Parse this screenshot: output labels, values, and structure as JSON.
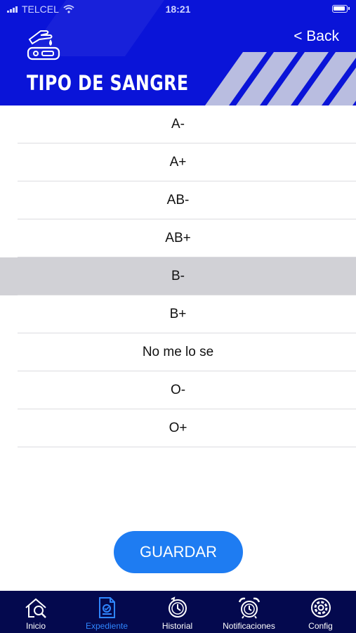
{
  "status_bar": {
    "carrier": "TELCEL",
    "time": "18:21"
  },
  "header": {
    "title": "TIPO DE SANGRE",
    "back_label": "< Back",
    "icon": "blood-test-icon"
  },
  "options": [
    {
      "label": "A-",
      "selected": false
    },
    {
      "label": "A+",
      "selected": false
    },
    {
      "label": "AB-",
      "selected": false
    },
    {
      "label": "AB+",
      "selected": false
    },
    {
      "label": "B-",
      "selected": true
    },
    {
      "label": "B+",
      "selected": false
    },
    {
      "label": "No me lo se",
      "selected": false
    },
    {
      "label": "O-",
      "selected": false
    },
    {
      "label": "O+",
      "selected": false
    }
  ],
  "save_button": {
    "label": "GUARDAR"
  },
  "tabs": [
    {
      "label": "Inicio",
      "icon": "home-search-icon",
      "active": false
    },
    {
      "label": "Expediente",
      "icon": "medical-record-icon",
      "active": true
    },
    {
      "label": "Historial",
      "icon": "history-clock-icon",
      "active": false
    },
    {
      "label": "Notificaciones",
      "icon": "alarm-clock-icon",
      "active": false
    },
    {
      "label": "Config",
      "icon": "settings-gear-icon",
      "active": false
    }
  ],
  "colors": {
    "header_blue": "#0a14d8",
    "tab_bar": "#04094e",
    "accent": "#1e7cf2",
    "selected_row": "#d1d1d6"
  }
}
